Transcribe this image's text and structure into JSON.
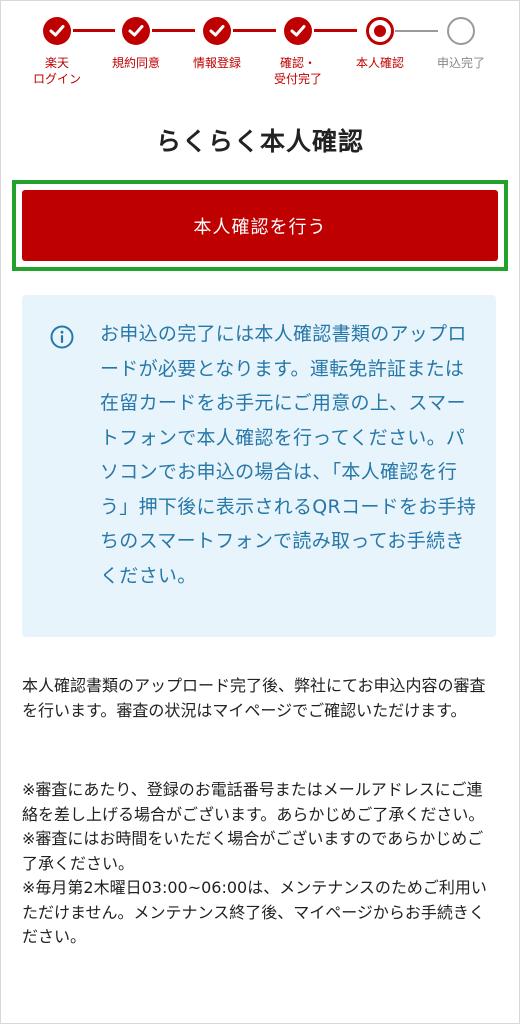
{
  "stepper": {
    "steps": [
      {
        "label": "楽天\nログイン",
        "state": "done"
      },
      {
        "label": "規約同意",
        "state": "done"
      },
      {
        "label": "情報登録",
        "state": "done"
      },
      {
        "label": "確認・\n受付完了",
        "state": "done"
      },
      {
        "label": "本人確認",
        "state": "current"
      },
      {
        "label": "申込完了",
        "state": "todo"
      }
    ]
  },
  "page": {
    "title": "らくらく本人確認"
  },
  "cta": {
    "label": "本人確認を行う"
  },
  "info": {
    "icon": "info-circle-icon",
    "text": "お申込の完了には本人確認書類のアップロードが必要となります。運転免許証または在留カードをお手元にご用意の上、スマートフォンで本人確認を行ってください。パソコンでお申込の場合は、「本人確認を行う」押下後に表示されるQRコードをお手持ちのスマートフォンで読み取ってお手続きください。"
  },
  "description": {
    "text": "本人確認書類のアップロード完了後、弊社にてお申込内容の審査を行います。審査の状況はマイページでご確認いただけます。"
  },
  "notes": [
    "※審査にあたり、登録のお電話番号またはメールアドレスにご連絡を差し上げる場合がございます。あらかじめご了承ください。",
    "※審査にはお時間をいただく場合がございますのであらかじめご了承ください。",
    "※毎月第2木曜日03:00~06:00は、メンテナンスのためご利用いただけません。メンテナンス終了後、マイページからお手続きください。"
  ],
  "colors": {
    "accent": "#bf0000",
    "highlight_border": "#22a12d",
    "info_bg": "#e8f4fb",
    "info_text": "#2778a8"
  }
}
